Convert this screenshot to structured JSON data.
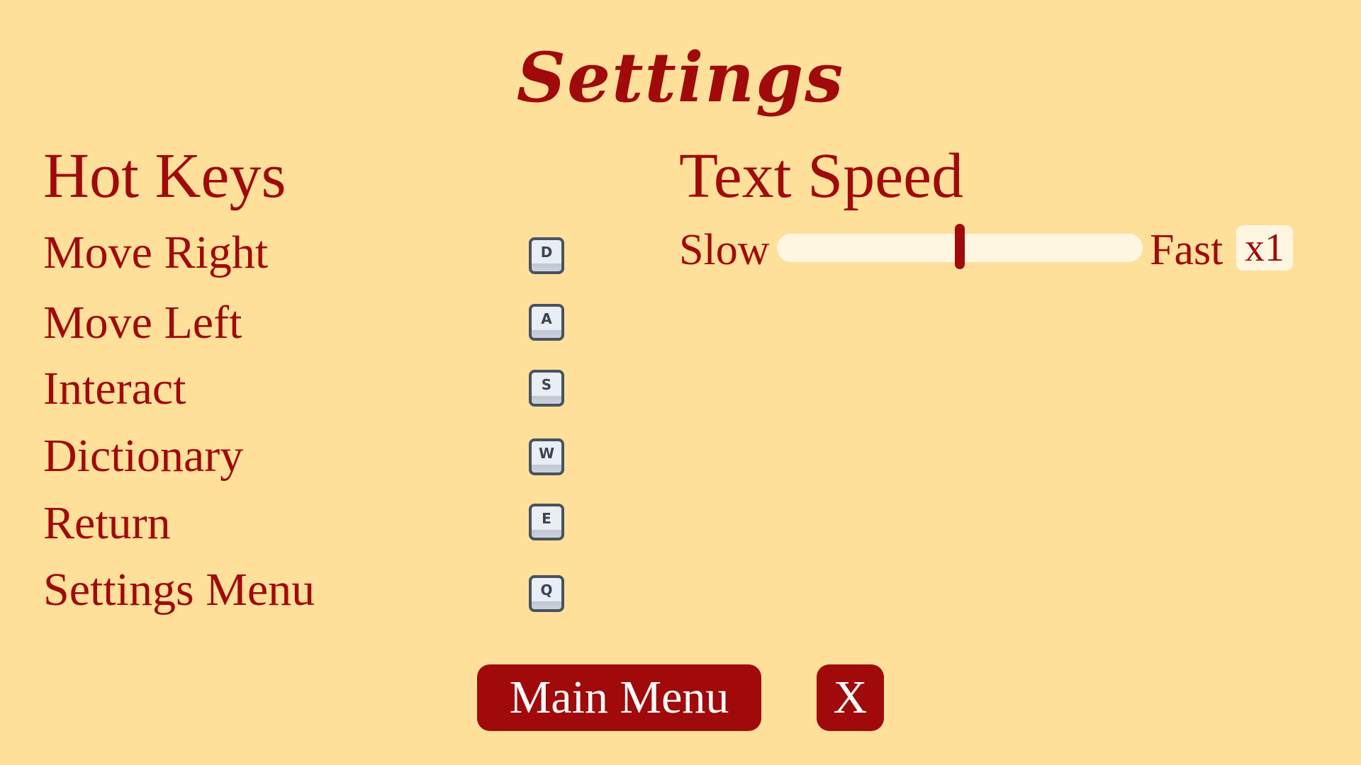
{
  "title": "Settings",
  "hotkeys": {
    "heading": "Hot Keys",
    "items": [
      {
        "label": "Move Right",
        "key": "D"
      },
      {
        "label": "Move Left",
        "key": "A"
      },
      {
        "label": "Interact",
        "key": "S"
      },
      {
        "label": "Dictionary",
        "key": "W"
      },
      {
        "label": "Return",
        "key": "E"
      },
      {
        "label": "Settings Menu",
        "key": "Q"
      }
    ]
  },
  "text_speed": {
    "heading": "Text Speed",
    "min_label": "Slow",
    "max_label": "Fast",
    "value_fraction": 0.5,
    "multiplier": "x1"
  },
  "buttons": {
    "main_menu": "Main Menu",
    "close": "X"
  },
  "colors": {
    "background": "#FEE09B",
    "accent": "#A00A0A",
    "track": "#FFF6E2"
  }
}
